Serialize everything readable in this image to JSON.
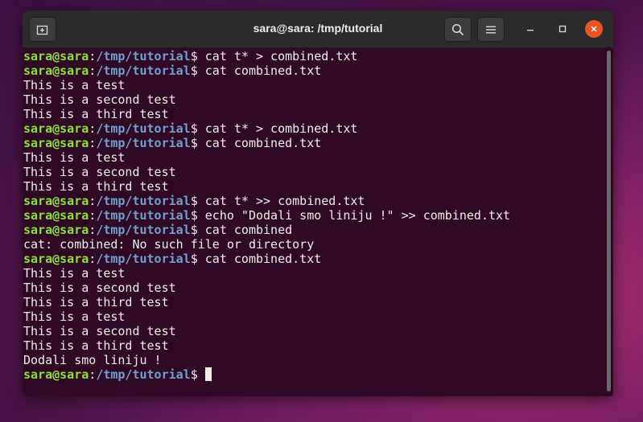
{
  "window": {
    "title": "sara@sara: /tmp/tutorial",
    "icons": {
      "new_tab": "new-tab-icon",
      "search": "search-icon",
      "menu": "hamburger-menu-icon",
      "minimize": "minimize-icon",
      "maximize": "maximize-icon",
      "close": "close-icon"
    }
  },
  "colors": {
    "terminal_bg": "#300a24",
    "prompt_user": "#8ae234",
    "prompt_path": "#729fcf",
    "text": "#eeeeec",
    "close_button": "#e95420"
  },
  "terminal": {
    "user": "sara@sara",
    "path": "/tmp/tutorial",
    "lines": [
      {
        "type": "prompt",
        "cmd": "cat t* > combined.txt"
      },
      {
        "type": "prompt",
        "cmd": "cat combined.txt"
      },
      {
        "type": "output",
        "text": "This is a test"
      },
      {
        "type": "output",
        "text": "This is a second test"
      },
      {
        "type": "output",
        "text": "This is a third test"
      },
      {
        "type": "prompt",
        "cmd": "cat t* > combined.txt"
      },
      {
        "type": "prompt",
        "cmd": "cat combined.txt"
      },
      {
        "type": "output",
        "text": "This is a test"
      },
      {
        "type": "output",
        "text": "This is a second test"
      },
      {
        "type": "output",
        "text": "This is a third test"
      },
      {
        "type": "prompt",
        "cmd": "cat t* >> combined.txt"
      },
      {
        "type": "prompt",
        "cmd": "echo \"Dodali smo liniju !\" >> combined.txt"
      },
      {
        "type": "prompt",
        "cmd": "cat combined"
      },
      {
        "type": "output",
        "text": "cat: combined: No such file or directory"
      },
      {
        "type": "prompt",
        "cmd": "cat combined.txt"
      },
      {
        "type": "output",
        "text": "This is a test"
      },
      {
        "type": "output",
        "text": "This is a second test"
      },
      {
        "type": "output",
        "text": "This is a third test"
      },
      {
        "type": "output",
        "text": "This is a test"
      },
      {
        "type": "output",
        "text": "This is a second test"
      },
      {
        "type": "output",
        "text": "This is a third test"
      },
      {
        "type": "output",
        "text": "Dodali smo liniju !"
      },
      {
        "type": "prompt",
        "cmd": "",
        "cursor": true
      }
    ]
  }
}
